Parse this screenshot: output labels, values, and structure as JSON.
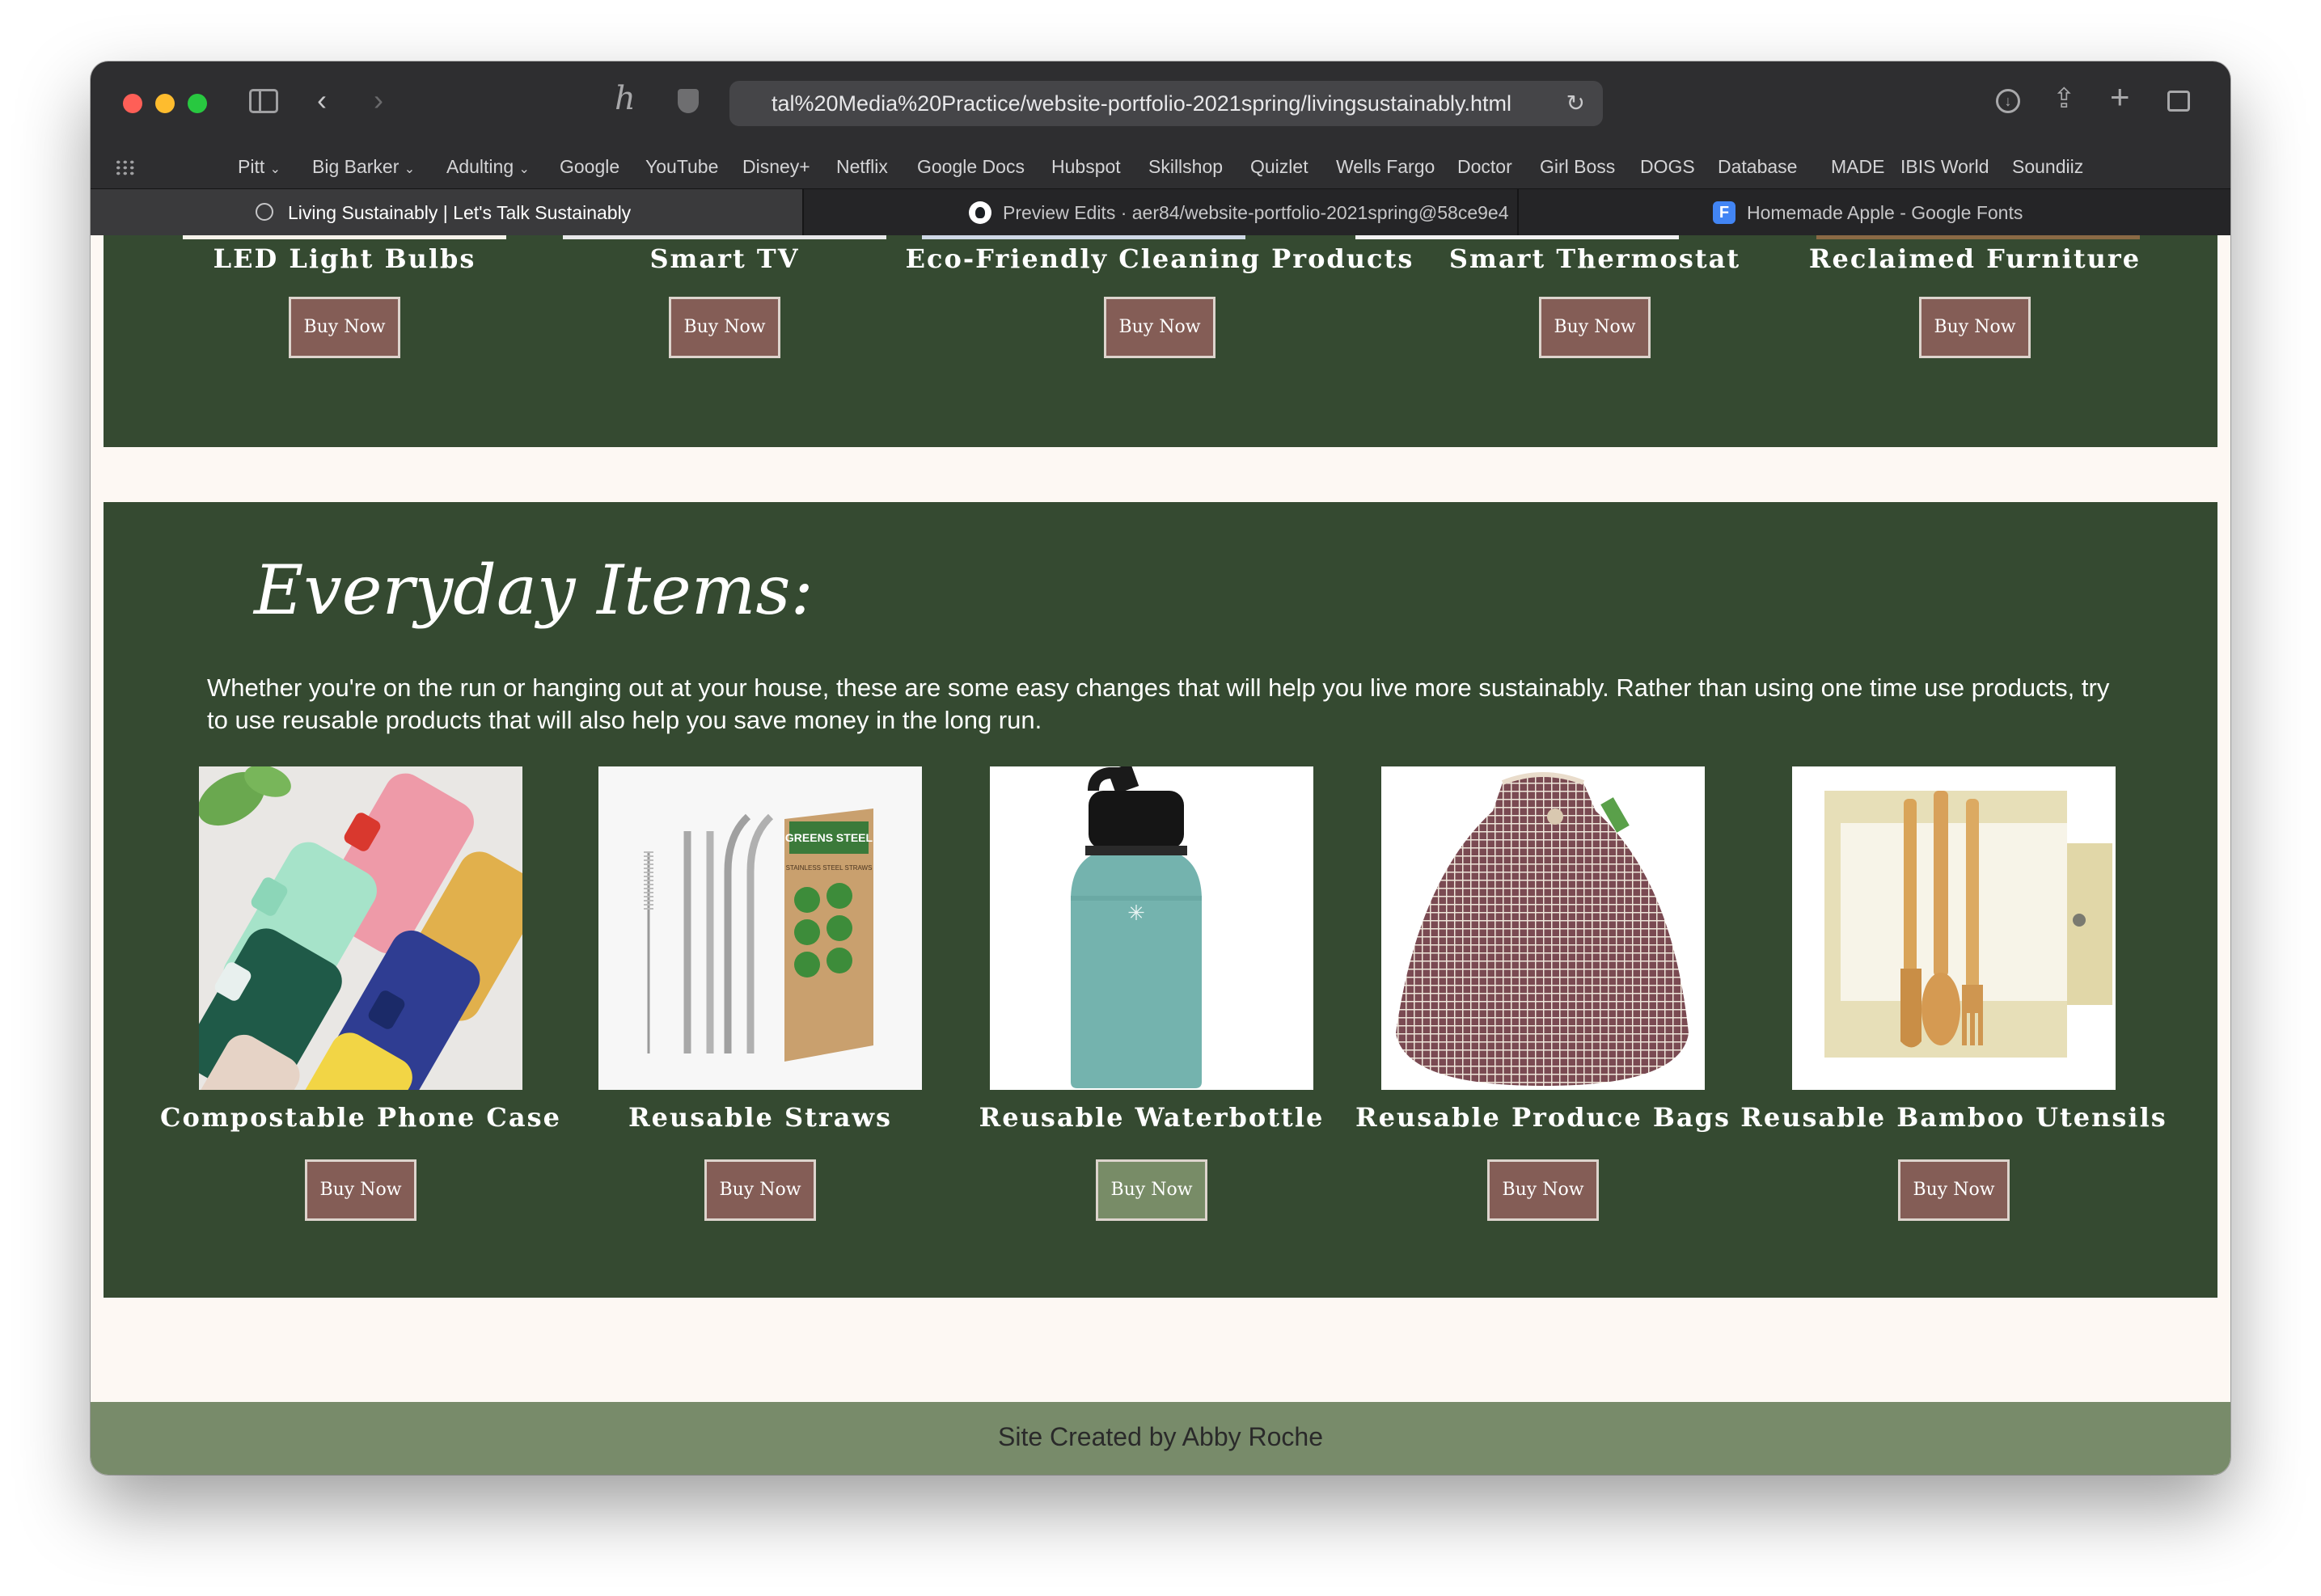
{
  "browser": {
    "url": "tal%20Media%20Practice/website-portfolio-2021spring/livingsustainably.html",
    "favorites": [
      "Pitt",
      "Big Barker",
      "Adulting",
      "Google",
      "YouTube",
      "Disney+",
      "Netflix",
      "Google Docs",
      "Hubspot",
      "Skillshop",
      "Quizlet",
      "Wells Fargo",
      "Doctor",
      "Girl Boss",
      "DOGS",
      "Database",
      "MADE",
      "IBIS World",
      "Soundiiz"
    ],
    "tabs": [
      "Living Sustainably | Let's Talk Sustainably",
      "Preview Edits · aer84/website-portfolio-2021spring@58ce9e4",
      "Homemade Apple - Google Fonts"
    ],
    "tab_favicon_letter": "F"
  },
  "top_section": {
    "products": [
      "LED Light Bulbs",
      "Smart TV",
      "Eco-Friendly Cleaning Products",
      "Smart Thermostat",
      "Reclaimed Furniture"
    ],
    "buy_label": "Buy Now"
  },
  "everyday": {
    "title": "Everyday Items:",
    "description": "Whether you're on the run or hanging out at your house, these are some easy changes that will help you live more sustainably. Rather than using one time use products, try to use reusable products that will also help you save money in the long run.",
    "products": [
      "Compostable Phone Case",
      "Reusable Straws",
      "Reusable Waterbottle",
      "Reusable Produce Bags",
      "Reusable Bamboo Utensils"
    ],
    "buy_label": "Buy Now",
    "straws_box_brand": "GREENS STEEL",
    "straws_box_line": "STAINLESS STEEL STRAWS"
  },
  "footer": {
    "text": "Site Created by Abby Roche"
  },
  "colors": {
    "section_green": "#354a31",
    "button_brown": "#845d56",
    "button_hover": "#788c67",
    "footer_green": "#788b6a",
    "page_cream": "#fdf8f3"
  }
}
